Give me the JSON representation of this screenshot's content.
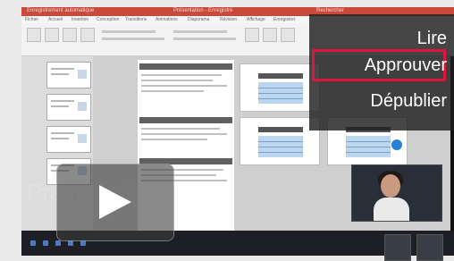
{
  "window": {
    "title_left": "Enregistrement automatique",
    "title_center": "Présentation - Enregistré",
    "title_right": "Rechercher"
  },
  "ribbon": {
    "tabs": [
      "Fichier",
      "Accueil",
      "Insertion",
      "Conception",
      "Transitions",
      "Animations",
      "Diaporama",
      "Révision",
      "Affichage",
      "Enregistrer"
    ]
  },
  "menu": {
    "items": [
      "Lire",
      "Approuver",
      "Dépublier"
    ],
    "selected": "Approuver",
    "highlight_color": "#e0143c"
  },
  "overlay": {
    "caption": "Présentations"
  },
  "colors": {
    "titlebar": "#c94a3b",
    "table": "#bcd6ee"
  },
  "icons": [
    "play-icon",
    "gear-icon"
  ]
}
